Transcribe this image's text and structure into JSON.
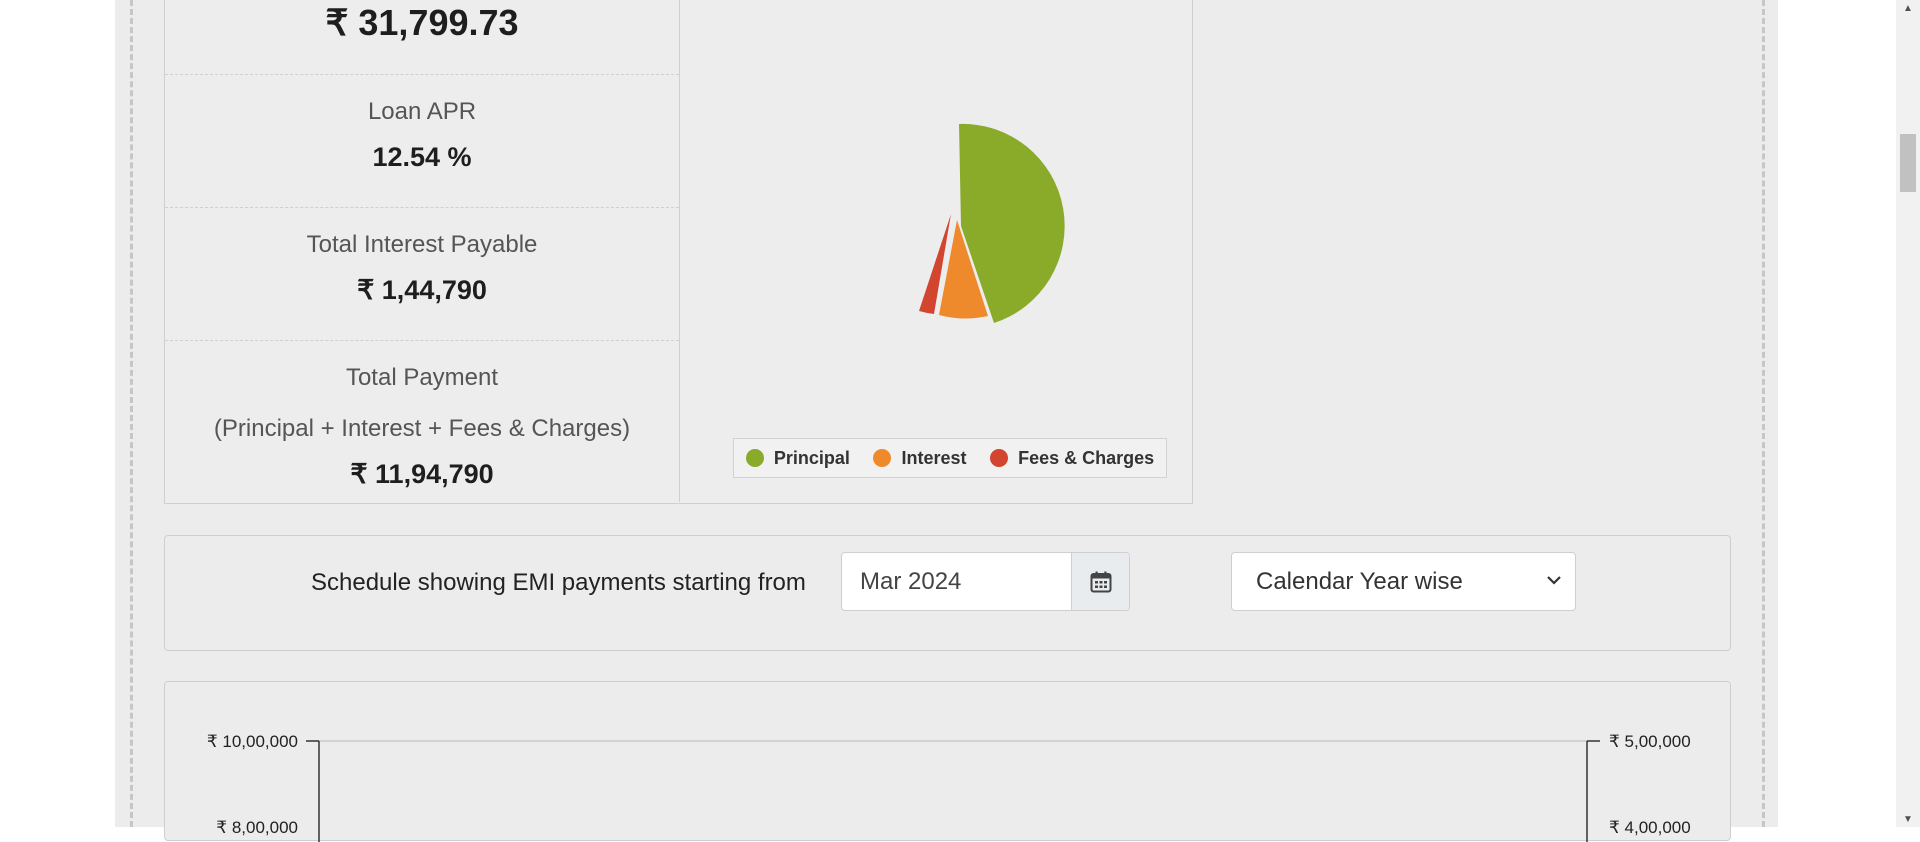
{
  "results": {
    "emi_value": "₹ 31,799.73",
    "apr_label": "Loan APR",
    "apr_value": "12.54 %",
    "interest_label": "Total Interest Payable",
    "interest_value": "₹ 1,44,790",
    "total_label_line1": "Total Payment",
    "total_label_line2": "(Principal + Interest + Fees & Charges)",
    "total_value": "₹ 11,94,790"
  },
  "pie": {
    "legend": [
      {
        "label": "Principal",
        "color": "#8aab2a"
      },
      {
        "label": "Interest",
        "color": "#ef8a2c"
      },
      {
        "label": "Fees & Charges",
        "color": "#d2462f"
      }
    ]
  },
  "schedule": {
    "text": "Schedule showing EMI payments starting from",
    "date_value": "Mar 2024",
    "select_value": "Calendar Year wise",
    "calendar_icon": "calendar-icon"
  },
  "chart_data": {
    "type": "bar",
    "left_axis_ticks": [
      "₹ 10,00,000",
      "₹ 8,00,000"
    ],
    "right_axis_ticks": [
      "₹ 5,00,000",
      "₹ 4,00,000"
    ]
  },
  "colors": {
    "principal": "#8aab2a",
    "interest": "#ef8a2c",
    "fees": "#d2462f"
  }
}
